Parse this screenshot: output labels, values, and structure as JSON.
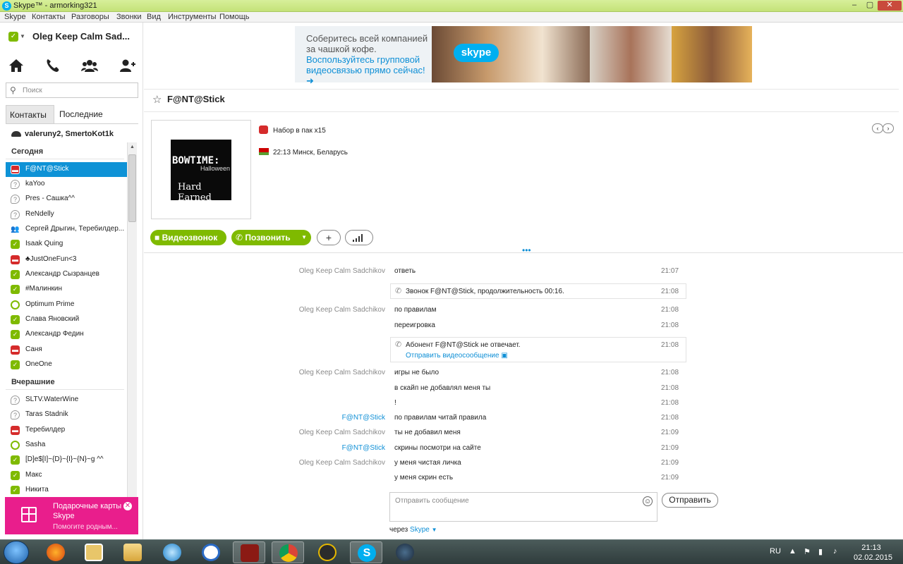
{
  "window": {
    "title": "Skype™ - armorking321"
  },
  "menu": [
    "Skype",
    "Контакты",
    "Разговоры",
    "Звонки",
    "Вид",
    "Инструменты",
    "Помощь"
  ],
  "user": {
    "name": "Oleg Keep Calm Sad..."
  },
  "search": {
    "placeholder": "Поиск"
  },
  "tabs": {
    "contacts": "Контакты",
    "recent": "Последние"
  },
  "pinned": "valeruny2, SmertoKot1k",
  "sections": {
    "today": "Сегодня",
    "yesterday": "Вчерашние"
  },
  "contacts_today": [
    {
      "name": "F@NT@Stick",
      "status": "red"
    },
    {
      "name": "kaYoo",
      "status": "gray"
    },
    {
      "name": "Pres - Сашка^^",
      "status": "gray"
    },
    {
      "name": "ReNdelly",
      "status": "gray"
    },
    {
      "name": "Сергей Дрыгин, Теребилдер...",
      "status": "group"
    },
    {
      "name": "Isaak Quing",
      "status": "green"
    },
    {
      "name": "♣JustOneFun<3",
      "status": "red"
    },
    {
      "name": "Александр Сызранцев",
      "status": "green"
    },
    {
      "name": "#Малинкин",
      "status": "green"
    },
    {
      "name": "Optimum Prime",
      "status": "ring"
    },
    {
      "name": "Слава Яновский",
      "status": "green"
    },
    {
      "name": "Александр Федин",
      "status": "green"
    },
    {
      "name": "Саня",
      "status": "red"
    },
    {
      "name": "OneOne",
      "status": "green"
    }
  ],
  "contacts_yesterday": [
    {
      "name": "SLTV.WaterWine",
      "status": "gray"
    },
    {
      "name": "Taras  Stadnik",
      "status": "gray"
    },
    {
      "name": "Теребилдер",
      "status": "red"
    },
    {
      "name": "Sasha",
      "status": "ring"
    },
    {
      "name": "[D]e$[I]~{D}~{I}~{N}~g ^^",
      "status": "green"
    },
    {
      "name": "Макс",
      "status": "green"
    },
    {
      "name": "Никита",
      "status": "green"
    }
  ],
  "promo": {
    "title": "Подарочные карты Skype",
    "subtitle": "Помогите родным..."
  },
  "ad": {
    "line1": "Соберитесь всей компанией за чашкой кофе.",
    "line2": "Воспользуйтесь групповой видеосвязью прямо сейчас! ➜",
    "brand": "skype"
  },
  "chat": {
    "title": "F@NT@Stick",
    "mood": "Набор в пак x15",
    "location": "22:13 Минск, Беларусь",
    "avatar_text": [
      "BOWTIME:",
      "Halloween",
      "Hard Earned"
    ],
    "video_call": "Видеозвонок",
    "call": "Позвонить"
  },
  "messages": [
    {
      "type": "msg",
      "sender": "Oleg Keep Calm Sadchikov",
      "text": "ответь",
      "time": "21:07"
    },
    {
      "type": "call",
      "text": "Звонок F@NT@Stick, продолжительность 00:16.",
      "time": "21:08"
    },
    {
      "type": "msg",
      "sender": "Oleg Keep Calm Sadchikov",
      "text": "по правилам",
      "time": "21:08"
    },
    {
      "type": "msg",
      "sender": "",
      "text": "переигровка",
      "time": "21:08"
    },
    {
      "type": "call2",
      "text": "Абонент F@NT@Stick не отвечает.",
      "link": "Отправить видеосообщение",
      "time": "21:08"
    },
    {
      "type": "msg",
      "sender": "Oleg Keep Calm Sadchikov",
      "text": "игры не было",
      "time": "21:08"
    },
    {
      "type": "msg",
      "sender": "",
      "text": "в скайп не добавлял меня ты",
      "time": "21:08"
    },
    {
      "type": "msg",
      "sender": "",
      "text": "!",
      "time": "21:08"
    },
    {
      "type": "msg",
      "sender": "F@NT@Stick",
      "sender_blue": true,
      "text": "по правилам читай правила",
      "time": "21:08"
    },
    {
      "type": "msg",
      "sender": "Oleg Keep Calm Sadchikov",
      "text": "ты не добавил меня",
      "time": "21:09"
    },
    {
      "type": "msg",
      "sender": "F@NT@Stick",
      "sender_blue": true,
      "text": "скрины посмотри на сайте",
      "time": "21:09"
    },
    {
      "type": "msg",
      "sender": "Oleg Keep Calm Sadchikov",
      "text": "у меня чистая личка",
      "time": "21:09"
    },
    {
      "type": "msg",
      "sender": "",
      "text": "у меня скрин есть",
      "time": "21:09"
    }
  ],
  "composer": {
    "placeholder": "Отправить сообщение",
    "send": "Отправить",
    "via_prefix": "через",
    "via_service": "Skype"
  },
  "taskbar": {
    "lang": "RU",
    "time": "21:13",
    "date": "02.02.2015"
  },
  "colors": {
    "accent": "#0e92d6",
    "online": "#7fba00",
    "busy": "#d52b2b",
    "promo": "#e91e8c"
  }
}
